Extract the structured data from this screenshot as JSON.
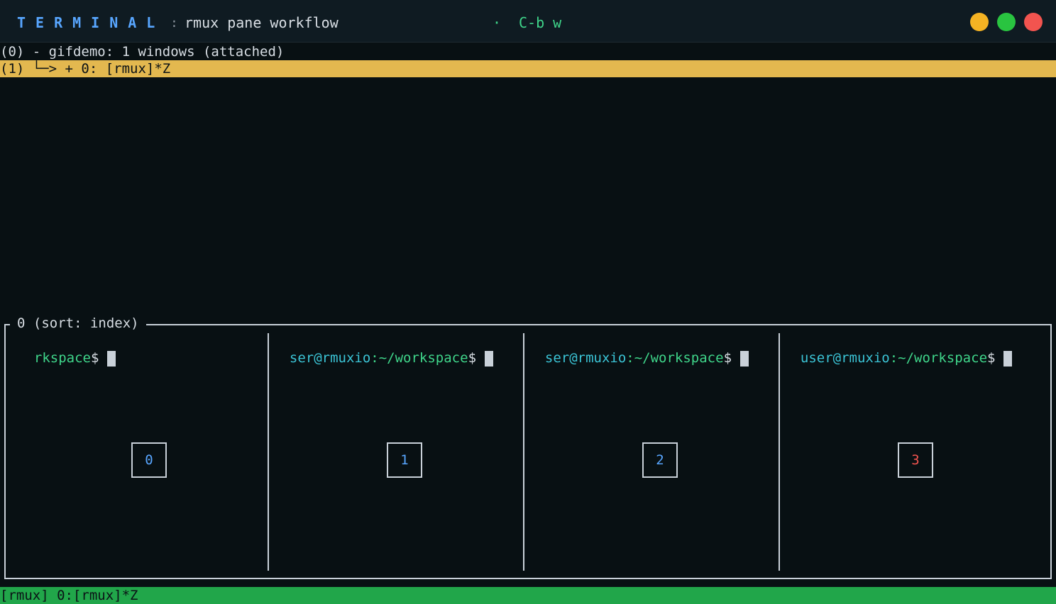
{
  "colors": {
    "selected_bg": "#e3b84f",
    "status_bg": "#21a64a",
    "btn_min": "#f5b323",
    "btn_max": "#29c440",
    "btn_close": "#f2544f",
    "pane_num_normal": "#58a6ff",
    "pane_num_active": "#f2544f"
  },
  "titlebar": {
    "brand": "TERMINAL",
    "separator": ":",
    "title": "rmux pane workflow",
    "dot": "·",
    "keys": "C-b w"
  },
  "tree": {
    "session_line": "(0) - gifdemo: 1 windows (attached)",
    "window_line": "(1) └─> + 0: [rmux]*Z"
  },
  "preview": {
    "label": "0 (sort: index)",
    "panes": [
      {
        "user": "",
        "path": "rkspace",
        "dollar": "$",
        "number": "0"
      },
      {
        "user": "ser@rmuxio",
        "path": ":~/workspace",
        "dollar": "$",
        "number": "1"
      },
      {
        "user": "ser@rmuxio",
        "path": ":~/workspace",
        "dollar": "$",
        "number": "2"
      },
      {
        "user": "user@rmuxio",
        "path": ":~/workspace",
        "dollar": "$",
        "number": "3"
      }
    ]
  },
  "statusbar": {
    "text": "[rmux] 0:[rmux]*Z"
  }
}
